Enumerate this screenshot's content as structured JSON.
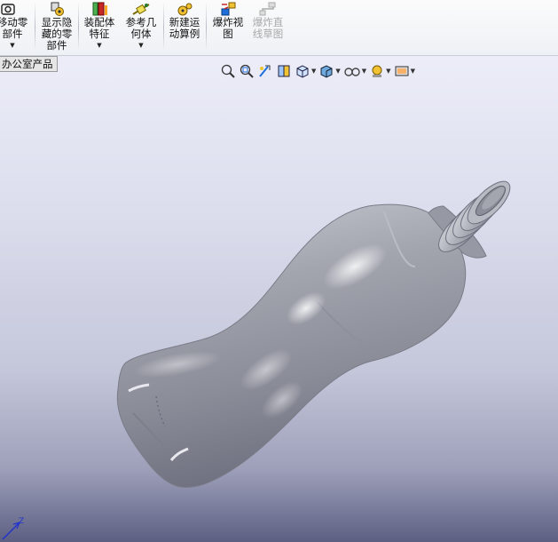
{
  "ribbon": {
    "commands": [
      {
        "label": "移动零\n部件",
        "icon": "move-component-icon",
        "has_dropdown": true
      },
      {
        "label": "显示隐\n藏的零\n部件",
        "icon": "show-hidden-components-icon",
        "has_dropdown": false
      },
      {
        "label": "装配体\n特征",
        "icon": "assembly-features-icon",
        "has_dropdown": true
      },
      {
        "label": "参考几\n何体",
        "icon": "reference-geometry-icon",
        "has_dropdown": true
      },
      {
        "label": "新建运\n动算例",
        "icon": "new-motion-study-icon",
        "has_dropdown": false
      },
      {
        "label": "爆炸视\n图",
        "icon": "exploded-view-icon",
        "has_dropdown": false
      },
      {
        "label": "爆炸直\n线草图",
        "icon": "explode-line-sketch-icon",
        "has_dropdown": false,
        "disabled": true
      }
    ]
  },
  "document_tab": "办公室产品",
  "headsup_toolbar": [
    {
      "icon": "zoom-to-fit-icon"
    },
    {
      "icon": "zoom-to-area-icon"
    },
    {
      "icon": "previous-view-icon"
    },
    {
      "icon": "section-view-icon"
    },
    {
      "icon": "view-orientation-icon",
      "dropdown": true
    },
    {
      "icon": "display-style-icon",
      "dropdown": true
    },
    {
      "icon": "hide-show-items-icon",
      "dropdown": true
    },
    {
      "icon": "edit-appearance-icon",
      "dropdown": true
    },
    {
      "icon": "apply-scene-icon",
      "dropdown": true
    }
  ],
  "model": {
    "name": "plastic-bottle",
    "color": "#9a9ca8"
  },
  "triad": {
    "axis_label": "Z"
  },
  "colors": {
    "viewport_top": "#ecedf8",
    "viewport_bottom": "#5c5f82",
    "axis_blue": "#2233cc"
  }
}
